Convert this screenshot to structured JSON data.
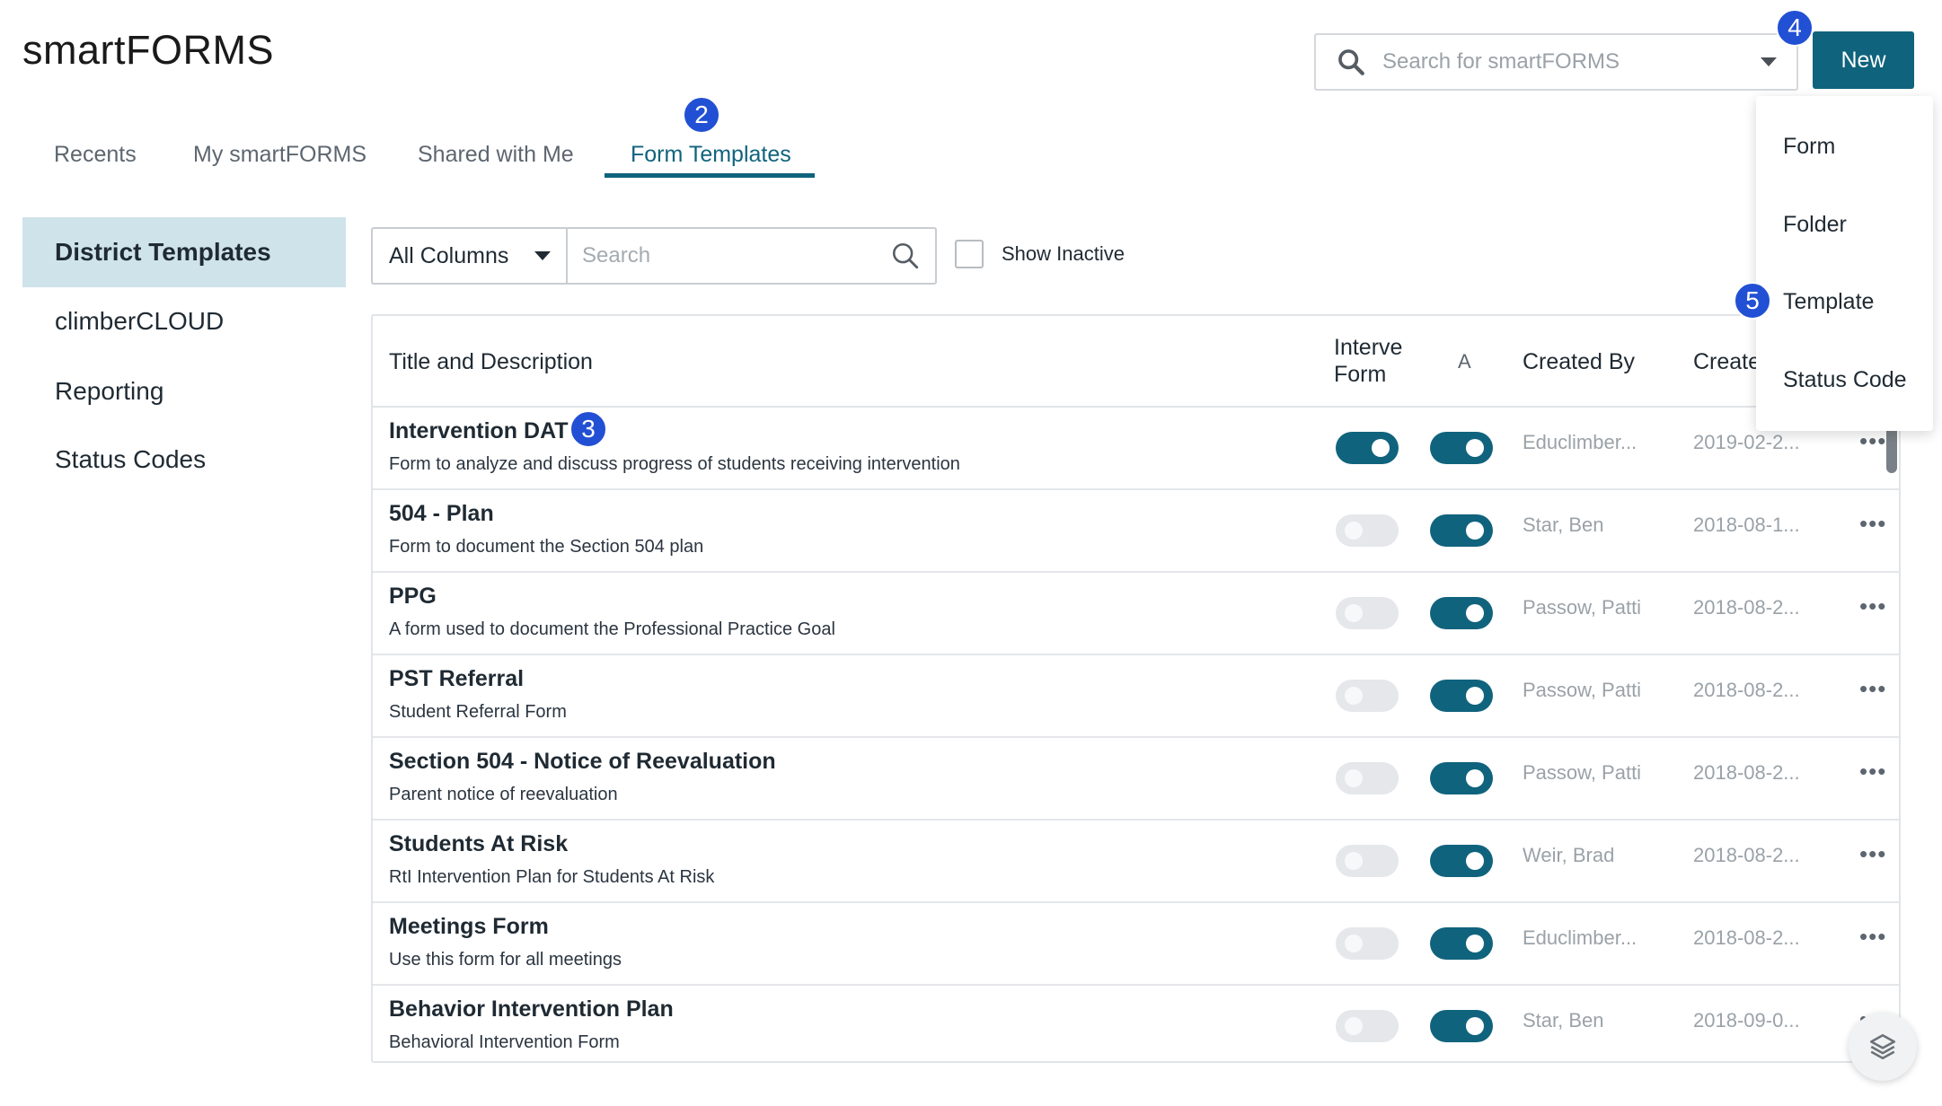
{
  "app": {
    "title": "smartFORMS"
  },
  "header": {
    "search_placeholder": "Search for smartFORMS",
    "new_label": "New"
  },
  "badges": {
    "b2": "2",
    "b3": "3",
    "b4": "4",
    "b5": "5",
    "badge_color": "#2250d4"
  },
  "new_menu": {
    "items": [
      "Form",
      "Folder",
      "Template",
      "Status Code"
    ]
  },
  "tabs": [
    "Recents",
    "My smartFORMS",
    "Shared with Me",
    "Form Templates"
  ],
  "active_tab": "Form Templates",
  "sidebar": {
    "items": [
      "District Templates",
      "climberCLOUD",
      "Reporting",
      "Status Codes"
    ]
  },
  "filter": {
    "column_select": "All Columns",
    "search_placeholder": "Search",
    "show_inactive_label": "Show Inactive"
  },
  "table": {
    "headers": {
      "title": "Title and Description",
      "intervention_line1": "Interve",
      "intervention_line2": "Form",
      "active": "A",
      "created_by": "Created By",
      "created_on": "Create"
    },
    "rows": [
      {
        "title": "Intervention DAT",
        "desc": "Form to analyze and discuss progress of students receiving intervention",
        "intervention": true,
        "active": true,
        "created_by": "Educlimber...",
        "created_on": "2019-02-2..."
      },
      {
        "title": "504 - Plan",
        "desc": "Form to document the Section 504 plan",
        "intervention": false,
        "active": true,
        "created_by": "Star, Ben",
        "created_on": "2018-08-1..."
      },
      {
        "title": "PPG",
        "desc": "A form used to document the Professional Practice Goal",
        "intervention": false,
        "active": true,
        "created_by": "Passow, Patti",
        "created_on": "2018-08-2..."
      },
      {
        "title": "PST Referral",
        "desc": "Student Referral Form",
        "intervention": false,
        "active": true,
        "created_by": "Passow, Patti",
        "created_on": "2018-08-2..."
      },
      {
        "title": "Section 504 - Notice of Reevaluation",
        "desc": "Parent notice of reevaluation",
        "intervention": false,
        "active": true,
        "created_by": "Passow, Patti",
        "created_on": "2018-08-2..."
      },
      {
        "title": "Students At Risk",
        "desc": "RtI Intervention Plan for Students At Risk",
        "intervention": false,
        "active": true,
        "created_by": "Weir, Brad",
        "created_on": "2018-08-2..."
      },
      {
        "title": "Meetings Form",
        "desc": "Use this form for all meetings",
        "intervention": false,
        "active": true,
        "created_by": "Educlimber...",
        "created_on": "2018-08-2..."
      },
      {
        "title": "Behavior Intervention Plan",
        "desc": "Behavioral Intervention Form",
        "intervention": false,
        "active": true,
        "created_by": "Star, Ben",
        "created_on": "2018-09-0..."
      }
    ],
    "more_glyph": "•••"
  },
  "colors": {
    "accent": "#10637d",
    "sidebar_active_bg": "#cfe3ea",
    "toggle_off": "#e5e7ea"
  },
  "icons": {
    "search": "search-icon",
    "caret": "caret-down-icon",
    "more": "more-horizontal-icon",
    "layers": "layers-icon"
  }
}
